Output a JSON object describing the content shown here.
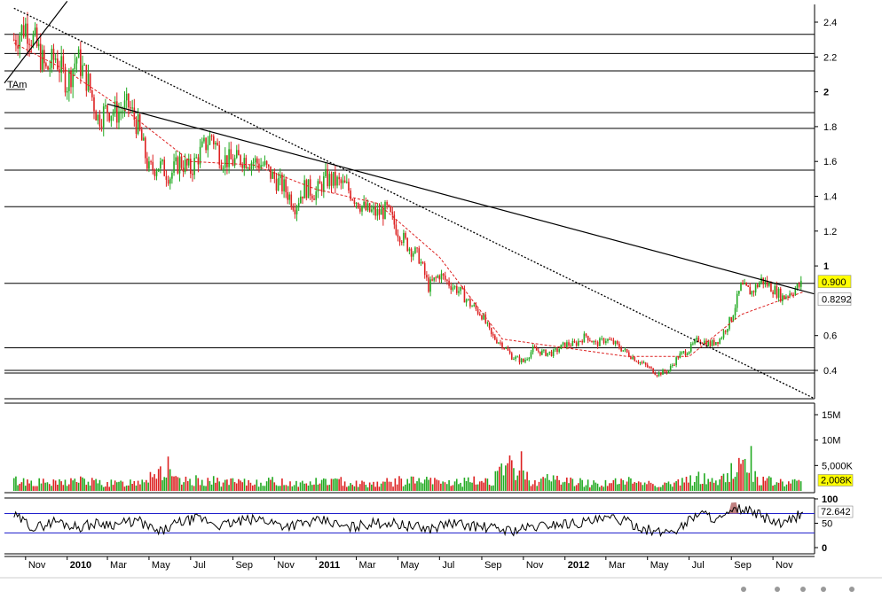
{
  "chart_data": [
    {
      "type": "line",
      "panel": "price",
      "y_ticks": [
        "2.4",
        "2.2",
        "2",
        "1.8",
        "1.6",
        "1.4",
        "1.2",
        "1",
        "0.6",
        "0.4"
      ],
      "y_tick_values": [
        2.4,
        2.2,
        2.0,
        1.8,
        1.6,
        1.4,
        1.2,
        1.0,
        0.6,
        0.4
      ],
      "ylim": [
        0.3,
        2.5
      ],
      "series": [
        {
          "kind": "candles",
          "x": [
            "2009-10-15",
            "2009-11-01",
            "2009-11-15",
            "2009-12-01",
            "2009-12-15",
            "2010-01-01",
            "2010-01-15",
            "2010-02-01",
            "2010-02-15",
            "2010-03-01",
            "2010-03-15",
            "2010-04-01",
            "2010-04-15",
            "2010-05-01",
            "2010-05-15",
            "2010-06-01",
            "2010-06-15",
            "2010-07-01",
            "2010-07-15",
            "2010-08-01",
            "2010-08-15",
            "2010-09-01",
            "2010-09-15",
            "2010-10-01",
            "2010-10-15",
            "2010-11-01",
            "2010-11-15",
            "2010-12-01",
            "2010-12-15",
            "2011-01-01",
            "2011-01-15",
            "2011-02-01",
            "2011-02-15",
            "2011-03-01",
            "2011-03-15",
            "2011-04-01",
            "2011-04-15",
            "2011-05-01",
            "2011-05-15",
            "2011-06-01",
            "2011-06-15",
            "2011-07-01",
            "2011-07-15",
            "2011-08-01",
            "2011-08-15",
            "2011-09-01",
            "2011-09-15",
            "2011-10-01",
            "2011-10-15",
            "2011-11-01",
            "2011-11-15",
            "2011-12-01",
            "2011-12-15",
            "2012-01-01",
            "2012-01-15",
            "2012-02-01",
            "2012-02-15",
            "2012-03-01",
            "2012-03-15",
            "2012-04-01",
            "2012-04-15",
            "2012-05-01",
            "2012-05-15",
            "2012-06-01",
            "2012-06-15",
            "2012-07-01",
            "2012-07-15",
            "2012-08-01",
            "2012-08-15",
            "2012-09-01",
            "2012-09-15",
            "2012-10-01",
            "2012-10-15",
            "2012-11-01",
            "2012-11-15",
            "2012-12-01",
            "2012-12-15"
          ],
          "values": [
            2.3,
            2.38,
            2.28,
            2.12,
            2.2,
            2.05,
            2.2,
            2.05,
            1.85,
            1.9,
            1.88,
            1.92,
            1.8,
            1.55,
            1.58,
            1.52,
            1.6,
            1.55,
            1.65,
            1.75,
            1.62,
            1.6,
            1.62,
            1.6,
            1.58,
            1.5,
            1.45,
            1.35,
            1.45,
            1.42,
            1.5,
            1.48,
            1.45,
            1.38,
            1.32,
            1.3,
            1.32,
            1.2,
            1.12,
            1.05,
            0.88,
            0.95,
            0.9,
            0.85,
            0.78,
            0.72,
            0.6,
            0.55,
            0.48,
            0.45,
            0.52,
            0.5,
            0.5,
            0.55,
            0.55,
            0.6,
            0.55,
            0.58,
            0.55,
            0.5,
            0.46,
            0.42,
            0.38,
            0.4,
            0.48,
            0.52,
            0.58,
            0.55,
            0.58,
            0.7,
            0.88,
            0.85,
            0.92,
            0.87,
            0.82,
            0.86,
            0.9
          ]
        },
        {
          "kind": "moving-average",
          "style": "dashed-red",
          "x": [
            "2009-10-15",
            "2010-01-01",
            "2010-04-01",
            "2010-07-01",
            "2010-10-01",
            "2011-01-01",
            "2011-04-01",
            "2011-07-01",
            "2011-10-01",
            "2012-01-01",
            "2012-04-01",
            "2012-07-01",
            "2012-09-15",
            "2012-12-15"
          ],
          "values": [
            2.28,
            2.12,
            1.88,
            1.6,
            1.58,
            1.44,
            1.36,
            1.05,
            0.58,
            0.53,
            0.48,
            0.48,
            0.72,
            0.85
          ]
        }
      ],
      "trendlines": [
        {
          "style": "solid",
          "x": [
            "2010-03-01",
            "2012-12-31"
          ],
          "y": [
            1.93,
            0.84
          ]
        },
        {
          "style": "dotted",
          "x": [
            "2009-10-15",
            "2012-12-31"
          ],
          "y": [
            2.48,
            0.24
          ]
        },
        {
          "style": "solid",
          "x": [
            "2009-10-01",
            "2010-01-01"
          ],
          "y": [
            2.05,
            2.52
          ]
        }
      ],
      "horizontal_levels": [
        2.33,
        2.22,
        2.12,
        1.88,
        1.79,
        1.55,
        1.34,
        0.9,
        0.53,
        0.4,
        0.385
      ],
      "annotation": "TAm",
      "price_labels": [
        {
          "text": "0.900",
          "value": 0.9,
          "color": "#ffff00"
        },
        {
          "text": "0.8292",
          "value": 0.8292,
          "color": "#ffffff"
        }
      ],
      "grid": false
    },
    {
      "type": "bar",
      "panel": "volume",
      "y_ticks": [
        "15M",
        "10M",
        "5,000K"
      ],
      "y_tick_values": [
        15000000,
        10000000,
        5000000
      ],
      "ylim": [
        0,
        18000000
      ],
      "x": [
        "2009-10-15",
        "2009-11-15",
        "2009-12-15",
        "2010-01-15",
        "2010-02-15",
        "2010-03-15",
        "2010-04-15",
        "2010-05-15",
        "2010-06-15",
        "2010-07-15",
        "2010-08-15",
        "2010-09-15",
        "2010-10-15",
        "2010-11-15",
        "2010-12-15",
        "2011-01-15",
        "2011-02-15",
        "2011-03-15",
        "2011-04-15",
        "2011-05-15",
        "2011-06-15",
        "2011-07-15",
        "2011-08-15",
        "2011-09-15",
        "2011-10-15",
        "2011-11-15",
        "2011-12-15",
        "2012-01-15",
        "2012-02-15",
        "2012-03-15",
        "2012-04-15",
        "2012-05-15",
        "2012-06-15",
        "2012-07-15",
        "2012-08-15",
        "2012-09-15",
        "2012-10-15",
        "2012-11-15",
        "2012-12-15"
      ],
      "values": [
        2500000,
        2200000,
        1800000,
        2600000,
        2000000,
        1700000,
        2400000,
        5200000,
        2100000,
        2600000,
        2200000,
        1900000,
        2300000,
        2100000,
        1800000,
        2400000,
        2200000,
        1700000,
        2100000,
        2500000,
        2300000,
        2000000,
        2200000,
        2700000,
        6000000,
        2400000,
        3000000,
        2200000,
        1800000,
        2100000,
        2400000,
        1600000,
        1900000,
        3200000,
        2200000,
        6800000,
        2500000,
        2000000,
        2008000
      ],
      "last_label": {
        "text": "2,008K",
        "color": "#ffff00"
      }
    },
    {
      "type": "line",
      "panel": "oscillator",
      "y_ticks": [
        "100",
        "50",
        "0"
      ],
      "y_tick_values": [
        100,
        50,
        0
      ],
      "ylim": [
        0,
        100
      ],
      "reference_lines": [
        70,
        30
      ],
      "x": [
        "2009-10-15",
        "2009-11-15",
        "2009-12-15",
        "2010-01-15",
        "2010-02-15",
        "2010-03-15",
        "2010-04-15",
        "2010-05-15",
        "2010-06-15",
        "2010-07-15",
        "2010-08-15",
        "2010-09-15",
        "2010-10-15",
        "2010-11-15",
        "2010-12-15",
        "2011-01-15",
        "2011-02-15",
        "2011-03-15",
        "2011-04-15",
        "2011-05-15",
        "2011-06-15",
        "2011-07-15",
        "2011-08-15",
        "2011-09-15",
        "2011-10-15",
        "2011-11-15",
        "2011-12-15",
        "2012-01-15",
        "2012-02-15",
        "2012-03-15",
        "2012-04-15",
        "2012-05-15",
        "2012-06-15",
        "2012-07-15",
        "2012-08-15",
        "2012-09-15",
        "2012-10-15",
        "2012-11-15",
        "2012-12-15"
      ],
      "values": [
        65,
        40,
        55,
        42,
        50,
        48,
        55,
        30,
        52,
        60,
        45,
        55,
        58,
        45,
        50,
        55,
        40,
        48,
        52,
        45,
        38,
        50,
        45,
        40,
        35,
        42,
        48,
        50,
        55,
        60,
        45,
        30,
        38,
        72,
        58,
        80,
        65,
        45,
        72.642
      ],
      "last_label": {
        "text": "72.642",
        "color": "#ffffff"
      }
    }
  ],
  "x_axis": {
    "ticks": [
      "Nov",
      "2010",
      "Mar",
      "May",
      "Jul",
      "Sep",
      "Nov",
      "2011",
      "Mar",
      "May",
      "Jul",
      "Sep",
      "Nov",
      "2012",
      "Mar",
      "May",
      "Jul",
      "Sep",
      "Nov"
    ],
    "tick_dates": [
      "2009-11-01",
      "2010-01-01",
      "2010-03-01",
      "2010-05-01",
      "2010-07-01",
      "2010-09-01",
      "2010-11-01",
      "2011-01-01",
      "2011-03-01",
      "2011-05-01",
      "2011-07-01",
      "2011-09-01",
      "2011-11-01",
      "2012-01-01",
      "2012-03-01",
      "2012-05-01",
      "2012-07-01",
      "2012-09-01",
      "2012-11-01"
    ],
    "bold_ticks": [
      "2010",
      "2011",
      "2012"
    ]
  },
  "colors": {
    "up": "#22aa22",
    "down": "#dd2222",
    "ma": "#dd2222",
    "osc_line": "#000000",
    "osc_ref": "#2222cc",
    "osc_fill": "#c08080",
    "highlight": "#ffff00"
  }
}
